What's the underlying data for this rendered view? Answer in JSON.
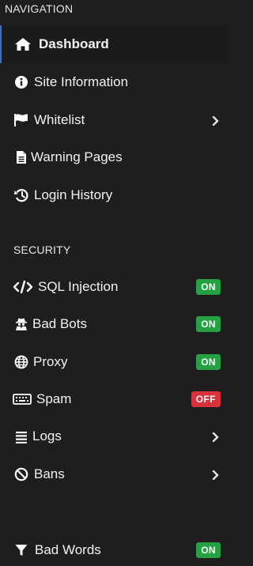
{
  "navigation": {
    "heading": "NAVIGATION",
    "items": [
      {
        "label": "Dashboard",
        "icon": "home-icon"
      },
      {
        "label": "Site Information",
        "icon": "info-icon"
      },
      {
        "label": "Whitelist",
        "icon": "flag-icon"
      },
      {
        "label": "Warning Pages",
        "icon": "file-icon"
      },
      {
        "label": "Login History",
        "icon": "history-icon"
      }
    ]
  },
  "security": {
    "heading": "SECURITY",
    "items": [
      {
        "label": "SQL Injection",
        "icon": "code-icon",
        "status": "ON"
      },
      {
        "label": "Bad Bots",
        "icon": "user-secret-icon",
        "status": "ON"
      },
      {
        "label": "Proxy",
        "icon": "globe-icon",
        "status": "ON"
      },
      {
        "label": "Spam",
        "icon": "keyboard-icon",
        "status": "OFF"
      },
      {
        "label": "Logs",
        "icon": "list-icon"
      },
      {
        "label": "Bans",
        "icon": "ban-icon"
      },
      {
        "label": "Bad Words",
        "icon": "filter-icon",
        "status": "ON"
      }
    ]
  },
  "colors": {
    "background": "#1e1d1f",
    "accent": "#3f6fc4",
    "status_on": "#26a043",
    "status_off": "#d9323c"
  }
}
